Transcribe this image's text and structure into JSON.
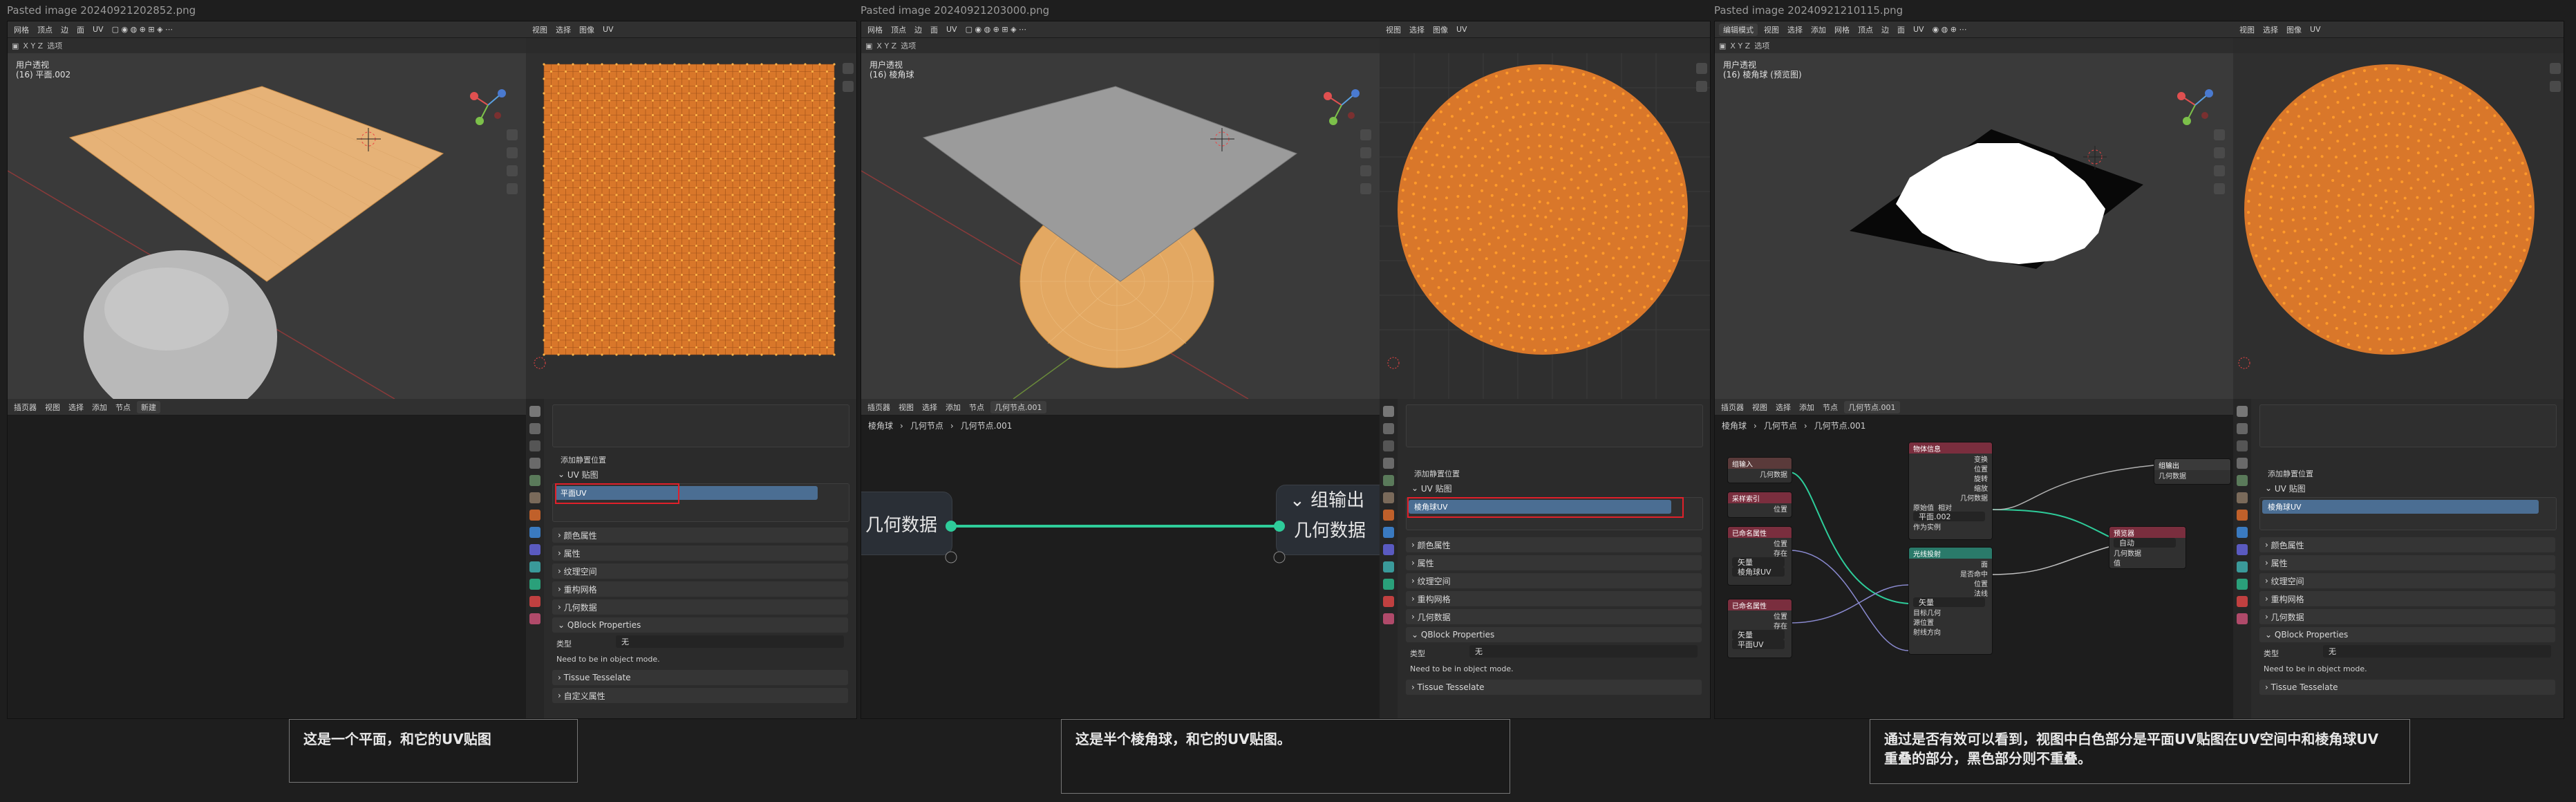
{
  "panels": [
    {
      "title": "Pasted image 20240921202852.png",
      "menu": [
        "网格",
        "顶点",
        "边",
        "面",
        "UV"
      ],
      "view_label1": "用户透视",
      "view_label2": "(16) 平面.002",
      "uv_menu": [
        "视图",
        "选择",
        "图像",
        "UV"
      ],
      "uv_mode": "选项",
      "bottom_left_menu": [
        "插页器",
        "视图",
        "选择",
        "添加",
        "节点"
      ],
      "new_button": "新建",
      "props": {
        "search": "",
        "add_sculpt": "添加静置位置",
        "uv_section": "UV 贴图",
        "uv_slot": "平面UV",
        "rows": [
          "颜色属性",
          "属性",
          "纹理空间",
          "重构网格",
          "几何数据"
        ],
        "qblock": "QBlock Properties",
        "type_label": "类型",
        "type_value": "无",
        "need_object_mode": "Need to be in object mode.",
        "tissue": "Tissue Tesselate",
        "custom": "自定义属性"
      },
      "caption": "这是一个平面，和它的UV贴图"
    },
    {
      "title": "Pasted image 20240921203000.png",
      "menu": [
        "网格",
        "顶点",
        "边",
        "面",
        "UV"
      ],
      "view_label1": "用户透视",
      "view_label2": "(16) 棱角球",
      "uv_menu": [
        "视图",
        "选择",
        "图像",
        "UV"
      ],
      "uv_mode": "选项",
      "bottom_left_menu": [
        "插页器",
        "视图",
        "选择",
        "添加",
        "节点"
      ],
      "breadcrumb": [
        "棱角球",
        "几何节点",
        "几何节点.001"
      ],
      "node_tab": "几何节点.001",
      "node_in": "几何数据",
      "node_out_header": "组输出",
      "node_out": "几何数据",
      "props": {
        "add_sculpt": "添加静置位置",
        "uv_section": "UV 贴图",
        "uv_slot": "棱角球UV",
        "rows": [
          "颜色属性",
          "属性",
          "纹理空间",
          "重构网格",
          "几何数据"
        ],
        "qblock": "QBlock Properties",
        "type_label": "类型",
        "type_value": "无",
        "need_object_mode": "Need to be in object mode.",
        "tissue": "Tissue Tesselate"
      },
      "caption": "这是半个棱角球，和它的UV贴图。"
    },
    {
      "title": "Pasted image 20240921210115.png",
      "menu": [
        "编辑模式",
        "视图",
        "选择",
        "添加",
        "网格",
        "顶点",
        "边",
        "面",
        "UV"
      ],
      "view_label1": "用户透视",
      "view_label2": "(16) 棱角球 (预览图)",
      "uv_menu": [
        "视图",
        "选择",
        "图像",
        "UV"
      ],
      "uv_mode": "选项",
      "bottom_left_menu": [
        "插页器",
        "视图",
        "选择",
        "添加",
        "节点"
      ],
      "breadcrumb": [
        "棱角球",
        "几何节点",
        "几何节点.001"
      ],
      "node_tab": "几何节点.001",
      "nodes": {
        "group_input": "组输入",
        "group_input_out": "几何数据",
        "sample": "采样索引",
        "object_info": "物体信息",
        "object_info_rows": [
          "变换",
          "位置",
          "旋转",
          "缩放",
          "几何数据"
        ],
        "object_info_opts": [
          "原始值",
          "相对"
        ],
        "object_name": "平面.002",
        "as_instance": "作为实例",
        "named_attr1": "已命名属性",
        "named_attr1_type": "矢量",
        "named_attr1_name": "棱角球UV",
        "named_attr2": "已命名属性",
        "named_attr2_type": "矢量",
        "named_attr2_name": "平面UV",
        "raycast": "光线投射",
        "raycast_rows": [
          "面",
          "是否命中",
          "位置",
          "法线",
          "距离"
        ],
        "raycast_inputs": [
          "目标几何",
          "源位置",
          "射线方向",
          "射线长度"
        ],
        "raycast_mode": "矢量",
        "viewer": "预览器",
        "viewer_mode": "自动",
        "viewer_rows": [
          "几何数据",
          "值"
        ],
        "group_output": "组输出",
        "group_output_row": "几何数据",
        "pos": "位置",
        "exists": "存在"
      },
      "props": {
        "add_sculpt": "添加静置位置",
        "uv_section": "UV 贴图",
        "uv_slot": "棱角球UV",
        "rows": [
          "颜色属性",
          "属性",
          "纹理空间",
          "重构网格",
          "几何数据"
        ],
        "qblock": "QBlock Properties",
        "type_label": "类型",
        "type_value": "无",
        "need_object_mode": "Need to be in object mode.",
        "tissue": "Tissue Tesselate"
      },
      "caption_line1": "通过是否有效可以看到，视图中白色部分是平面UV贴图在UV空间中和棱角球UV",
      "caption_line2": "重叠的部分，黑色部分则不重叠。"
    }
  ],
  "colors": {
    "uv_orange": "#d9772a",
    "uv_vertex": "#ff8c1a",
    "plane_orange": "#e6b277",
    "selection_blue": "#4b6e93",
    "link_green": "#2ecc9a",
    "highlight_red": "#e0202a"
  }
}
